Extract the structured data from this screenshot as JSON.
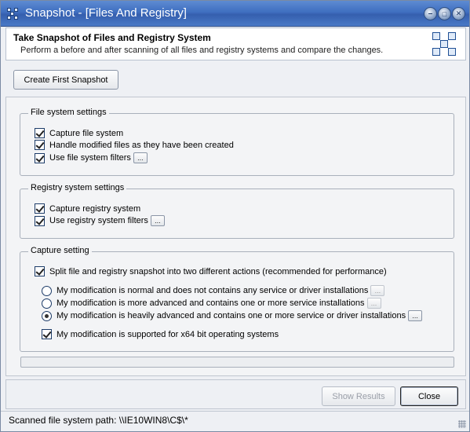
{
  "window": {
    "title": "Snapshot - [Files And Registry]"
  },
  "header": {
    "title": "Take Snapshot of Files and Registry System",
    "subtitle": "Perform a before and after scanning of all files and registry systems and compare the changes."
  },
  "actions": {
    "create_first_snapshot": "Create First Snapshot"
  },
  "file_system": {
    "group_label": "File system settings",
    "options": [
      {
        "label": "Capture file system",
        "checked": true
      },
      {
        "label": "Handle modified files as they have been created",
        "checked": true
      },
      {
        "label": "Use file system filters",
        "checked": true
      }
    ],
    "filter_button": "..."
  },
  "registry": {
    "group_label": "Registry system settings",
    "options": [
      {
        "label": "Capture registry system",
        "checked": true
      },
      {
        "label": "Use registry system filters",
        "checked": true
      }
    ],
    "filter_button": "..."
  },
  "capture": {
    "group_label": "Capture setting",
    "split_label": "Split file and registry snapshot into two different actions (recommended for performance)",
    "radios": [
      {
        "label": "My modification is normal and does not contains any service or driver installations",
        "selected": false
      },
      {
        "label": "My modification is more advanced and contains one or more service installations",
        "selected": false
      },
      {
        "label": "My modification is heavily advanced and contains one or more service or driver installations",
        "selected": true
      }
    ],
    "radio_button": "...",
    "x64_label": "My modification is supported for x64 bit operating systems"
  },
  "footer": {
    "show_results": "Show Results",
    "close": "Close"
  },
  "status": {
    "text": "Scanned file system path: \\\\IE10WIN8\\C$\\*"
  },
  "colors": {
    "titlebar": "#3f6fc0",
    "background": "#eef0f4"
  }
}
